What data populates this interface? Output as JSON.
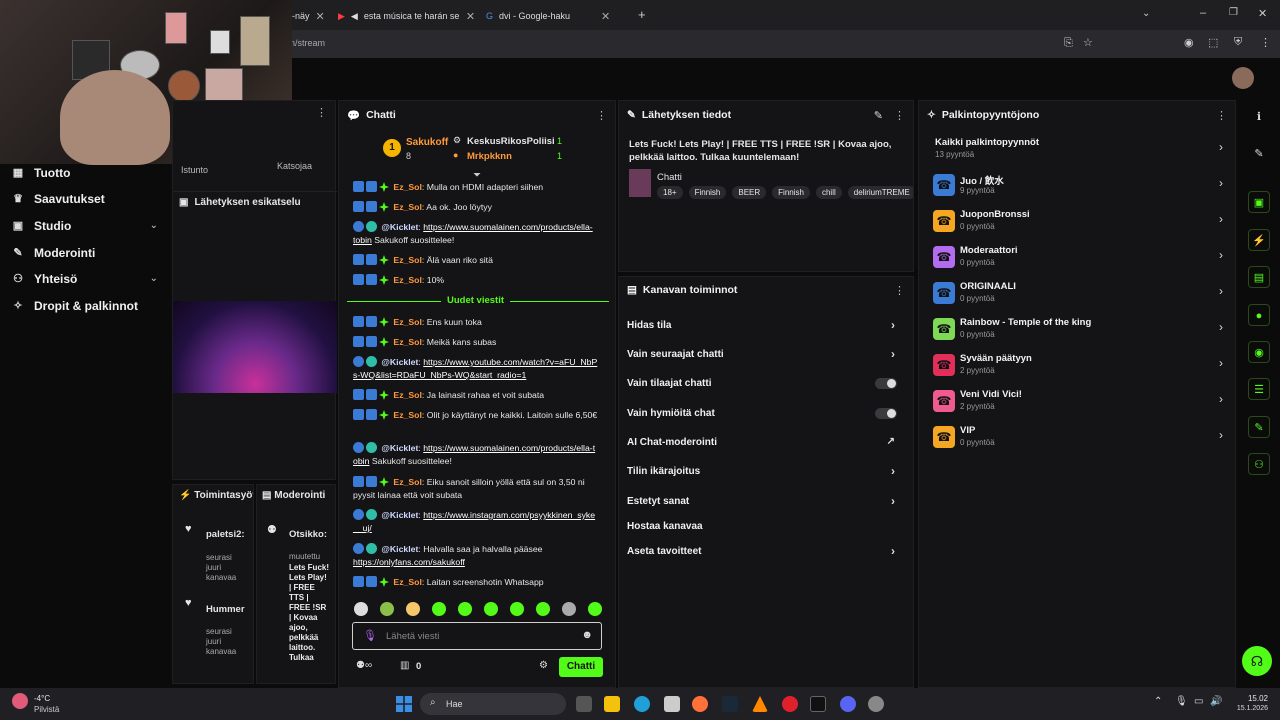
{
  "browser": {
    "tabs": [
      {
        "label": "-näy"
      },
      {
        "label": "esta música te harán sentir"
      },
      {
        "label": "dvi - Google-haku"
      }
    ],
    "url": "n/stream"
  },
  "nav": {
    "items": [
      {
        "label": "Tuotto"
      },
      {
        "label": "Saavutukset"
      },
      {
        "label": "Studio"
      },
      {
        "label": "Moderointi"
      },
      {
        "label": "Yhteisö"
      },
      {
        "label": "Dropit & palkinnot"
      }
    ]
  },
  "preview": {
    "istunto": "Istunto",
    "katsojaa": "Katsojaa",
    "title": "Lähetyksen esikatselu"
  },
  "bottom_panels": {
    "activity_title": "Toimintasyöt",
    "moderation_title": "Moderointi",
    "activity_items": [
      {
        "name": "paletsi2:",
        "sub": "seurasi juuri kanavaa"
      },
      {
        "name": "Hummer",
        "sub": "seurasi juuri kanavaa"
      }
    ],
    "mod_item_title": "Otsikko:",
    "mod_item_sub": "muutettu",
    "mod_item_text": "Lets Fuck! Lets Play! | FREE TTS | FREE !SR | Kovaa ajoo, pelkkää laittoo. Tulkaa"
  },
  "chat": {
    "title": "Chatti",
    "leaderboard": {
      "first": {
        "name": "Sakukoff",
        "count": "8"
      },
      "second": {
        "name": "KeskusRikosPoliisi",
        "count": "1"
      },
      "third": {
        "name": "Mrkpkknn",
        "count": "1"
      }
    },
    "new_messages_label": "Uudet viestit",
    "messages": [
      {
        "user": "Ez_Sol",
        "text": "Mulla on HDMI adapteri siihen"
      },
      {
        "user": "Ez_Sol",
        "text": "Aa ok. Joo löytyy"
      },
      {
        "user": "@Kicklet",
        "link": "https://www.suomalainen.com/products/ella-tobin",
        "text": " Sakukoff suosittelee!"
      },
      {
        "user": "Ez_Sol",
        "text": "Älä vaan riko sitä"
      },
      {
        "user": "Ez_Sol",
        "text": "10%"
      },
      {
        "user": "Ez_Sol",
        "text": "Ens kuun toka"
      },
      {
        "user": "Ez_Sol",
        "text": "Meikä kans subas"
      },
      {
        "user": "@Kicklet",
        "link": "https://www.youtube.com/watch?v=aFU_NbPs-WQ&list=RDaFU_NbPs-WQ&start_radio=1",
        "text": ""
      },
      {
        "user": "Ez_Sol",
        "text": "Ja lainasit rahaa et voit subata"
      },
      {
        "user": "Ez_Sol",
        "text": "Olit jo käyttänyt ne kaikki. Laitoin sulle 6,50€"
      },
      {
        "user": "@Kicklet",
        "link": "https://www.suomalainen.com/products/ella-tobin",
        "text": " Sakukoff suosittelee!"
      },
      {
        "user": "Ez_Sol",
        "text": "Eiku sanoit silloin yöllä että sul on 3,50 ni pyysit lainaa että voit subata"
      },
      {
        "user": "@Kicklet",
        "link": "https://www.instagram.com/psyykkinen_syke__uj/",
        "text": ""
      },
      {
        "user": "@Kicklet",
        "text": "Halvalla saa ja halvalla pääsee ",
        "link": "https://onlyfans.com/sakukoff"
      },
      {
        "user": "Ez_Sol",
        "text": "Laitan screenshotin Whatsapp"
      }
    ],
    "input_placeholder": "Lähetä viesti",
    "points": "0",
    "send_label": "Chatti"
  },
  "stream_info": {
    "title": "Lähetyksen tiedot",
    "stream_title": "Lets Fuck! Lets Play! | FREE TTS | FREE !SR | Kovaa ajoo, pelkkää laittoo. Tulkaa kuuntelemaan!",
    "category": "Chatti",
    "tags": [
      "18+",
      "Finnish",
      "BEER",
      "Finnish",
      "chill",
      "deliriumTREME"
    ]
  },
  "channel_actions": {
    "title": "Kanavan toiminnot",
    "items": [
      {
        "label": "Hidas tila",
        "control": "arrow"
      },
      {
        "label": "Vain seuraajat chatti",
        "control": "arrow"
      },
      {
        "label": "Vain tilaajat chatti",
        "control": "toggle"
      },
      {
        "label": "Vain hymiöitä chat",
        "control": "toggle"
      },
      {
        "label": "AI Chat-moderointi",
        "control": "external"
      },
      {
        "label": "Tilin ikärajoitus",
        "control": "arrow"
      },
      {
        "label": "Estetyt sanat",
        "control": "arrow"
      },
      {
        "label": "Hostaa kanavaa",
        "control": "none"
      },
      {
        "label": "Aseta tavoitteet",
        "control": "arrow"
      }
    ]
  },
  "rewards": {
    "title": "Palkintopyyntöjono",
    "items": [
      {
        "name": "Kaikki palkintopyynnöt",
        "sub": "13 pyyntöä",
        "color": ""
      },
      {
        "name": "Juo / 飲水",
        "sub": "9 pyyntöä",
        "color": "#3a7bd5"
      },
      {
        "name": "JuoponBronssi",
        "sub": "0 pyyntöä",
        "color": "#f5a623"
      },
      {
        "name": "Moderaattori",
        "sub": "0 pyyntöä",
        "color": "#b36bf0"
      },
      {
        "name": "ORIGINAALI",
        "sub": "0 pyyntöä",
        "color": "#3a7bd5"
      },
      {
        "name": "Rainbow - Temple of the king",
        "sub": "0 pyyntöä",
        "color": "#7ed957"
      },
      {
        "name": "Syvään päätyyn",
        "sub": "2 pyyntöä",
        "color": "#e0305a"
      },
      {
        "name": "Veni Vidi Vici!",
        "sub": "2 pyyntöä",
        "color": "#ef5b8c"
      },
      {
        "name": "VIP",
        "sub": "0 pyyntöä",
        "color": "#f5a623"
      }
    ]
  },
  "taskbar": {
    "weather_temp": "-4°C",
    "weather_desc": "Pilvistä",
    "search": "Hae",
    "time": "15.02",
    "date": "15.1.2026"
  },
  "colors": {
    "accent": "#53fc18",
    "panel": "#141416"
  }
}
